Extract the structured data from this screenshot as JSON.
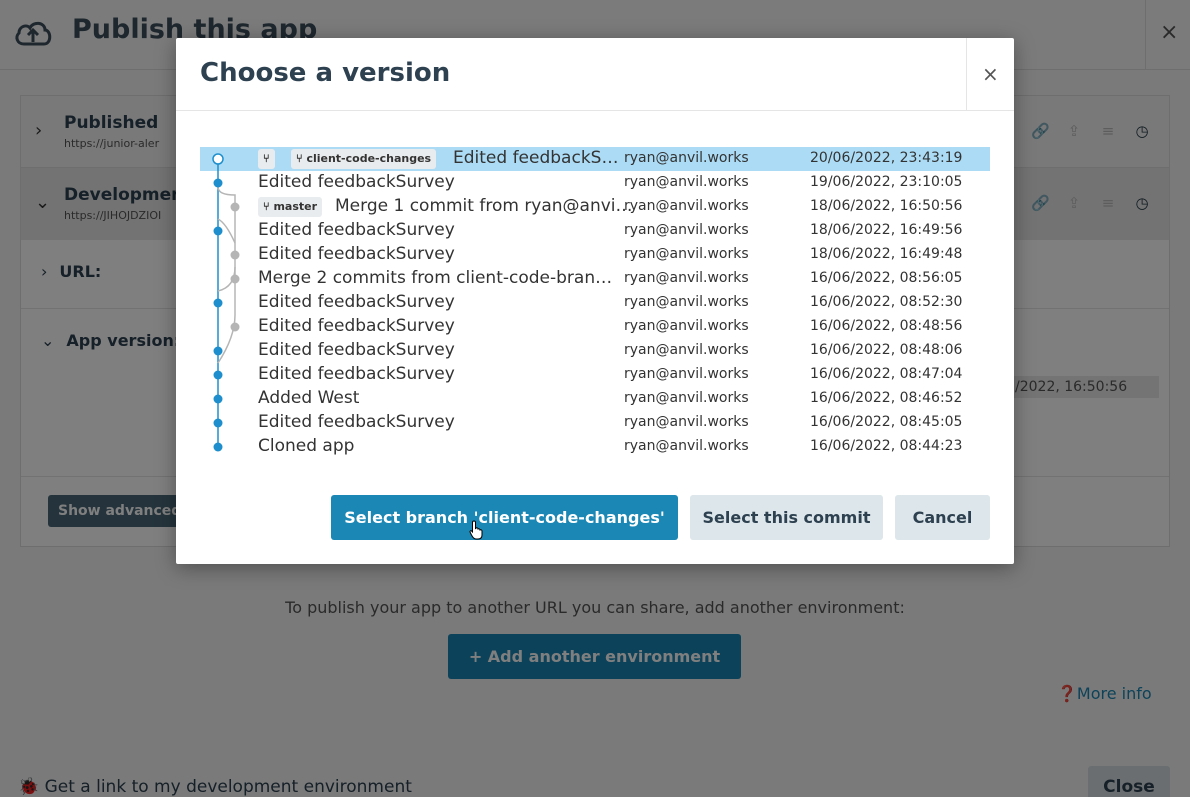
{
  "page": {
    "title": "Publish this app",
    "close_symbol": "×",
    "environments": [
      {
        "name": "Published",
        "url": "https://junior-aler"
      },
      {
        "name": "Development",
        "url": "https://JIHOJDZIOI"
      }
    ],
    "url_label": "URL:",
    "app_version_label": "App version:",
    "app_version_value": "/2022, 16:50:56",
    "show_advanced_label": "Show advanced",
    "publish_note": "To publish your app to another URL you can share, add another environment:",
    "add_env_label": "+ Add another environment",
    "more_info_label": "More info",
    "get_link_label": "Get a link to my development environment",
    "close_label": "Close"
  },
  "modal": {
    "title": "Choose a version",
    "close_symbol": "×",
    "commits": [
      {
        "message": "Edited feedbackS…",
        "email": "ryan@anvil.works",
        "date": "20/06/2022, 23:43:19",
        "tags": [
          "",
          "client-code-changes"
        ],
        "selected": true
      },
      {
        "message": "Edited feedbackSurvey",
        "email": "ryan@anvil.works",
        "date": "19/06/2022, 23:10:05"
      },
      {
        "message": "Merge 1 commit from ryan@anvi…",
        "email": "ryan@anvil.works",
        "date": "18/06/2022, 16:50:56",
        "tags": [
          "master"
        ]
      },
      {
        "message": "Edited feedbackSurvey",
        "email": "ryan@anvil.works",
        "date": "18/06/2022, 16:49:56"
      },
      {
        "message": "Edited feedbackSurvey",
        "email": "ryan@anvil.works",
        "date": "18/06/2022, 16:49:48"
      },
      {
        "message": "Merge 2 commits from client-code-bran…",
        "email": "ryan@anvil.works",
        "date": "16/06/2022, 08:56:05"
      },
      {
        "message": "Edited feedbackSurvey",
        "email": "ryan@anvil.works",
        "date": "16/06/2022, 08:52:30"
      },
      {
        "message": "Edited feedbackSurvey",
        "email": "ryan@anvil.works",
        "date": "16/06/2022, 08:48:56"
      },
      {
        "message": "Edited feedbackSurvey",
        "email": "ryan@anvil.works",
        "date": "16/06/2022, 08:48:06"
      },
      {
        "message": "Edited feedbackSurvey",
        "email": "ryan@anvil.works",
        "date": "16/06/2022, 08:47:04"
      },
      {
        "message": "Added West",
        "email": "ryan@anvil.works",
        "date": "16/06/2022, 08:46:52"
      },
      {
        "message": "Edited feedbackSurvey",
        "email": "ryan@anvil.works",
        "date": "16/06/2022, 08:45:05"
      },
      {
        "message": "Cloned app",
        "email": "ryan@anvil.works",
        "date": "16/06/2022, 08:44:23"
      }
    ],
    "select_branch_label": "Select branch 'client-code-changes'",
    "select_commit_label": "Select this commit",
    "cancel_label": "Cancel"
  },
  "colors": {
    "accent": "#1b87b5",
    "selected_row": "#acdcf5",
    "graph_main": "#1e8fcc",
    "graph_branch": "#b5b5b5"
  }
}
